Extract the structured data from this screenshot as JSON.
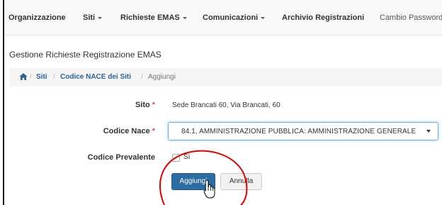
{
  "navbar": {
    "items": [
      {
        "label": "Organizzazione",
        "dropdown": false
      },
      {
        "label": "Siti",
        "dropdown": true
      },
      {
        "label": "Richieste EMAS",
        "dropdown": true
      },
      {
        "label": "Comunicazioni",
        "dropdown": true
      },
      {
        "label": "Archivio Registrazioni",
        "dropdown": false
      },
      {
        "label": "Cambio Password",
        "dropdown": false
      }
    ]
  },
  "page": {
    "heading": "Gestione Richieste Registrazione EMAS"
  },
  "breadcrumb": {
    "home_icon": "home-icon",
    "separator": "/",
    "items": [
      "Siti",
      "Codice NACE dei Siti",
      "Aggiungi"
    ]
  },
  "form": {
    "sito": {
      "label": "Sito",
      "required": "*",
      "value": "Sede Brancati 60, Via Brancati, 60"
    },
    "codice_nace": {
      "label": "Codice Nace",
      "required": "*",
      "selected": "84.1, AMMINISTRAZIONE PUBBLICA: AMMINISTRAZIONE GENERALE"
    },
    "codice_prevalente": {
      "label": "Codice Prevalente",
      "checkbox_label": "Sì",
      "checked": false
    }
  },
  "buttons": {
    "add": "Aggiungi",
    "cancel": "Annulla"
  },
  "colors": {
    "primary": "#2d6ca2",
    "link": "#2a6496",
    "required": "#d9534f",
    "annotation": "#e00000"
  }
}
